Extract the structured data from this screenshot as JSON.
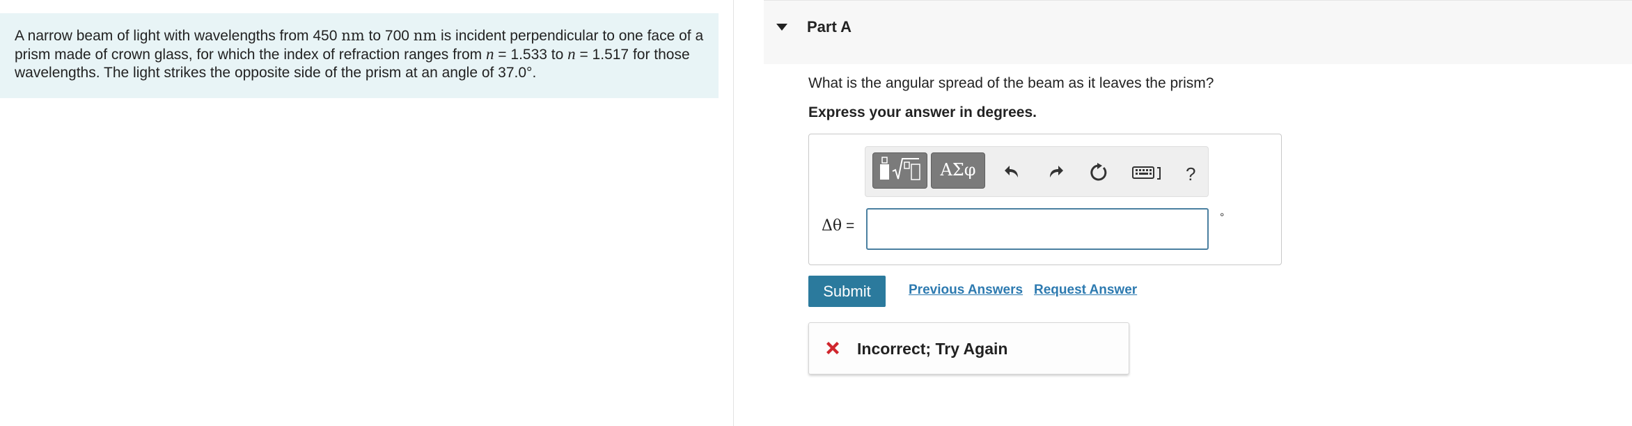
{
  "problem": {
    "seg1": "A narrow beam of light with wavelengths from 450 ",
    "unit1": "nm",
    "seg2": " to 700 ",
    "unit2": "nm",
    "seg3": " is incident perpendicular to one face of a",
    "line2_a": "prism made of crown glass, for which the index of refraction ranges from ",
    "var1": "n",
    "line2_b": " = 1.533 to ",
    "var2": "n",
    "line2_c": " = 1.517 for those",
    "line3": "wavelengths. The light strikes the opposite side of the prism at an angle of 37.0°."
  },
  "part": {
    "title": "Part A",
    "question": "What is the angular spread of the beam as it leaves the prism?",
    "instruction": "Express your answer in degrees."
  },
  "toolbar": {
    "symbols_label": "ΑΣφ",
    "help_label": "?",
    "icons": [
      "templates-icon",
      "undo-icon",
      "redo-icon",
      "reset-icon",
      "keyboard-icon",
      "help-icon"
    ]
  },
  "answer": {
    "label_var": "Δθ",
    "label_eq": " =",
    "value": "",
    "placeholder": "",
    "unit": "°"
  },
  "actions": {
    "submit": "Submit",
    "previous_answers": "Previous Answers",
    "request_answer": "Request Answer"
  },
  "feedback": {
    "text": "Incorrect; Try Again",
    "status_color": "#d0262d"
  },
  "colors": {
    "accent": "#2b7a9d",
    "link": "#2d7ab0",
    "problem_bg": "#e8f4f6"
  }
}
